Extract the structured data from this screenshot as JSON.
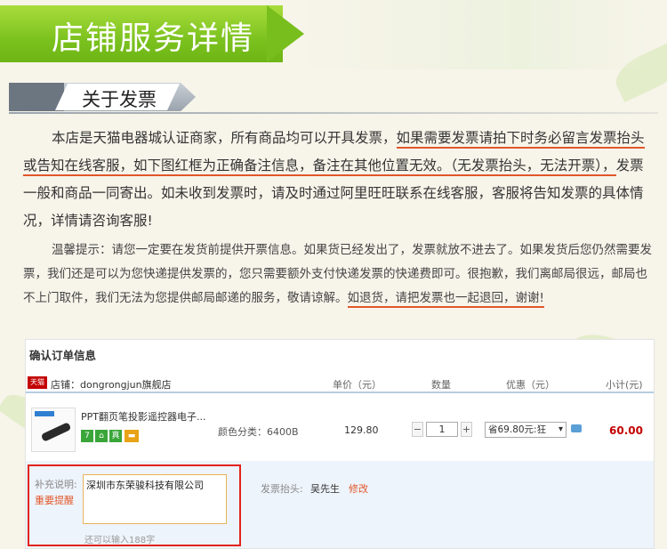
{
  "banner": {
    "title": "店铺服务详情"
  },
  "section": {
    "heading": "关于发票"
  },
  "paragraph1": {
    "part1": "本店是天猫电器城认证商家，所有商品均可以开具发票，",
    "part2": "如果需要发票请拍下时务必留言发票抬头或告知在线客服，",
    "part3": "如下图红框为正确备注信息，",
    "part4": "备注在其他位置无效。",
    "part5": "（无发票抬头，无法开票），",
    "part6": "发票一般和商品一同寄出。如未收到发票时，请及时通过阿里旺旺联系在线客服，客服将告知发票的具体情况，详情请咨询客服!"
  },
  "paragraph2": {
    "part1": "温馨提示：请您一定要在发货前提供开票信息。如果货已经发出了，发票就放不进去了。如果发货后您仍然需要发票，我们还是可以为您快递提供发票的，您只需要额外支付快递发票的快递费即可。很抱歉，我们离邮局很远，邮局也不上门取件，我们无法为您提供邮局邮递的服务，敬请谅解。",
    "part2": "如退货，请把发票也一起退回，谢谢!"
  },
  "order": {
    "title": "确认订单信息",
    "shop_badge": "天猫",
    "shop_label": "店铺：dongrongjun旗舰店",
    "columns": {
      "price": "单价（元）",
      "qty": "数量",
      "promo": "优惠（元）",
      "subtotal": "小计(元)"
    },
    "item": {
      "name": "PPT翻页笔投影遥控器电子...",
      "service_icons": [
        "7",
        "⌂",
        "真",
        "▬"
      ],
      "spec_label": "颜色分类：",
      "spec_value": "6400B",
      "price": "129.80",
      "qty": "1",
      "qty_minus": "−",
      "qty_plus": "+",
      "promo": "省69.80元:狂",
      "subtotal": "60.00"
    },
    "note": {
      "label": "补充说明:",
      "important": "重要提醒",
      "value": "深圳市东荣骏科技有限公司",
      "counter": "还可以输入188字"
    },
    "invoice": {
      "label": "发票抬头:",
      "value": "吴先生",
      "edit": "修改"
    }
  },
  "colors": {
    "accent_green": "#7cc21f",
    "underline": "#e1572a",
    "frame_red": "#e2231a",
    "price_red": "#c40000"
  }
}
